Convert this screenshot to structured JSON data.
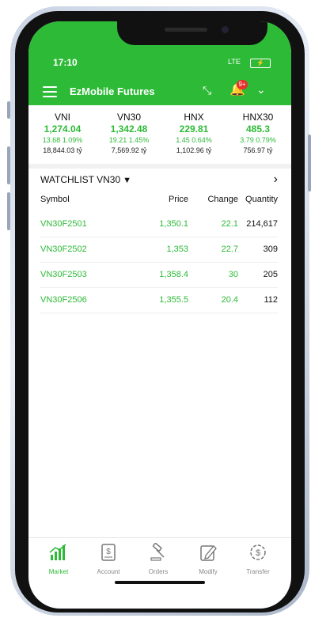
{
  "status_bar": {
    "time": "17:10",
    "signal": "LTE",
    "battery": "⚡"
  },
  "header": {
    "title": "EzMobile Futures",
    "notification_badge": "9+"
  },
  "indices": [
    {
      "name": "VNI",
      "value": "1,274.04",
      "change": "13.68 1.09%",
      "volume": "18,844.03 tỷ"
    },
    {
      "name": "VN30",
      "value": "1,342.48",
      "change": "19.21 1.45%",
      "volume": "7,569.92 tỷ"
    },
    {
      "name": "HNX",
      "value": "229.81",
      "change": "1.45 0.64%",
      "volume": "1,102.96 tỷ"
    },
    {
      "name": "HNX30",
      "value": "485.3",
      "change": "3.79 0.79%",
      "volume": "756.97 tỷ"
    }
  ],
  "watchlist": {
    "title": "WATCHLIST VN30",
    "caret": "▼",
    "next": "›",
    "columns": {
      "symbol": "Symbol",
      "price": "Price",
      "change": "Change",
      "quantity": "Quantity"
    },
    "rows": [
      {
        "symbol": "VN30F2501",
        "price": "1,350.1",
        "change": "22.1",
        "quantity": "214,617"
      },
      {
        "symbol": "VN30F2502",
        "price": "1,353",
        "change": "22.7",
        "quantity": "309"
      },
      {
        "symbol": "VN30F2503",
        "price": "1,358.4",
        "change": "30",
        "quantity": "205"
      },
      {
        "symbol": "VN30F2506",
        "price": "1,355.5",
        "change": "20.4",
        "quantity": "112"
      }
    ]
  },
  "nav": {
    "market": "Market",
    "account": "Account",
    "orders": "Orders",
    "modify": "Modify",
    "transfer": "Transfer"
  },
  "colors": {
    "accent": "#2dba37",
    "badge": "#e7302d"
  }
}
